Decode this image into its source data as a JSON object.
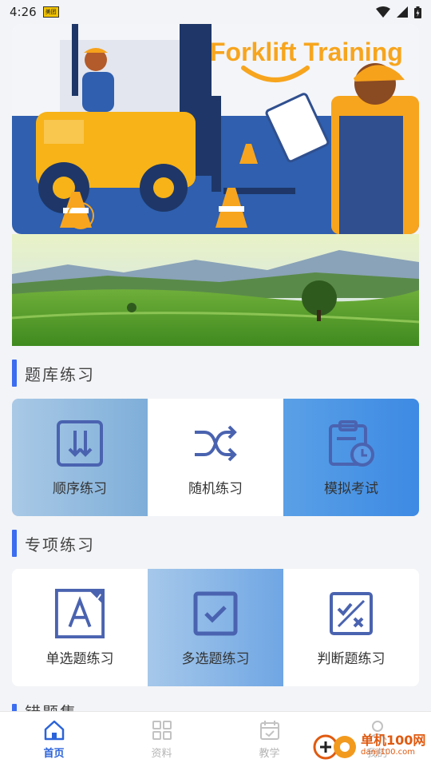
{
  "status_bar": {
    "time": "4:26",
    "app_icon_text": "美团",
    "icons": [
      "wifi-icon",
      "signal-icon",
      "battery-icon"
    ]
  },
  "banner": {
    "title": "Forklift Training"
  },
  "section1": {
    "title": "题库练习",
    "cards": [
      {
        "label": "顺序练习",
        "icon": "sequence-icon"
      },
      {
        "label": "随机练习",
        "icon": "shuffle-icon"
      },
      {
        "label": "模拟考试",
        "icon": "exam-clipboard-icon"
      }
    ]
  },
  "section2": {
    "title": "专项练习",
    "cards": [
      {
        "label": "单选题练习",
        "icon": "single-choice-icon"
      },
      {
        "label": "多选题练习",
        "icon": "multi-choice-icon"
      },
      {
        "label": "判断题练习",
        "icon": "judge-icon"
      }
    ]
  },
  "section3": {
    "title": "错题集"
  },
  "bottom_nav": {
    "items": [
      {
        "label": "首页",
        "icon": "home-icon",
        "active": true
      },
      {
        "label": "资料",
        "icon": "grid-icon",
        "active": false
      },
      {
        "label": "教学",
        "icon": "calendar-check-icon",
        "active": false
      },
      {
        "label": "我的",
        "icon": "user-icon",
        "active": false
      }
    ]
  },
  "watermark": {
    "main": "单机100网",
    "sub": "danji100.com"
  },
  "colors": {
    "accent": "#3b6df0",
    "nav_active": "#2b63d9",
    "icon_blue": "#4a63b0"
  }
}
